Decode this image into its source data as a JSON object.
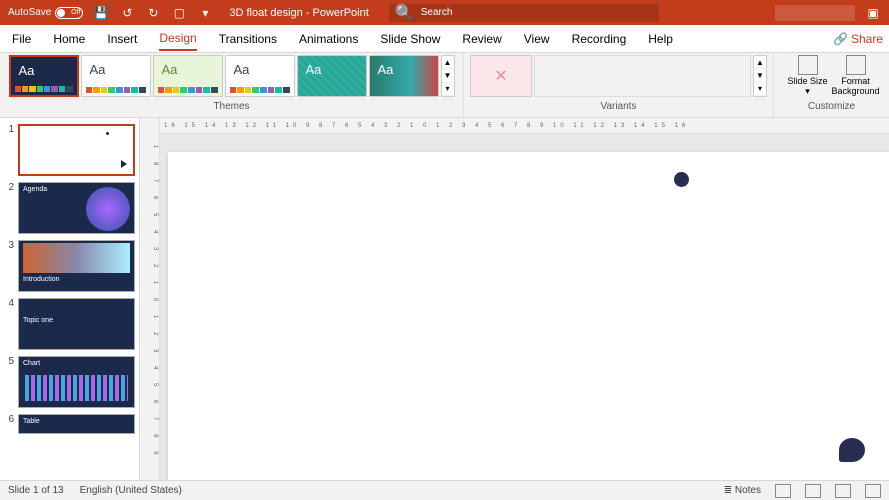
{
  "titlebar": {
    "autosave_label": "AutoSave",
    "autosave_state": "Off",
    "doc_title": "3D float design - PowerPoint",
    "search_placeholder": "Search"
  },
  "tabs": {
    "file": "File",
    "home": "Home",
    "insert": "Insert",
    "design": "Design",
    "transitions": "Transitions",
    "animations": "Animations",
    "slideshow": "Slide Show",
    "review": "Review",
    "view": "View",
    "recording": "Recording",
    "help": "Help",
    "share": "Share"
  },
  "ribbon": {
    "themes_label": "Themes",
    "variants_label": "Variants",
    "customize_label": "Customize",
    "slide_size": "Slide Size",
    "format_bg": "Format Background",
    "theme_aa": "Aa"
  },
  "thumbnails": [
    {
      "n": "1",
      "selected": true,
      "label": ""
    },
    {
      "n": "2",
      "selected": false,
      "label": "Agenda"
    },
    {
      "n": "3",
      "selected": false,
      "label": "Introduction"
    },
    {
      "n": "4",
      "selected": false,
      "label": "Topic one"
    },
    {
      "n": "5",
      "selected": false,
      "label": "Chart"
    },
    {
      "n": "6",
      "selected": false,
      "label": "Table"
    }
  ],
  "ruler": {
    "h": "16 15 14 13 12 11 10 9 8 7 6 5 4 3 2 1 0 1 2 3 4 5 6 7 8 9 10 11 12 13 14 15 16",
    "v": "1 8 7 6 5 4 3 2 1 0 1 2 3 4 5 6 7 8 9"
  },
  "status": {
    "slide": "Slide 1 of 13",
    "lang": "English (United States)",
    "notes": "Notes"
  },
  "swatches": [
    "#e84c3d",
    "#f39c12",
    "#f1c40f",
    "#2ecc71",
    "#3498db",
    "#9b59b6",
    "#1abc9c",
    "#34495e"
  ]
}
